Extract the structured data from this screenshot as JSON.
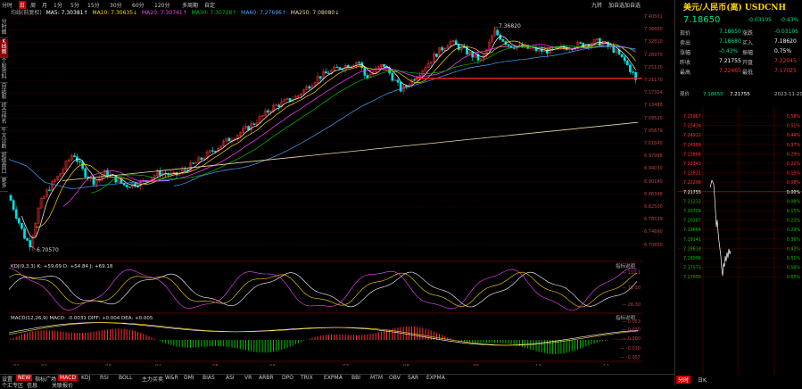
{
  "toolbar": {
    "items": [
      {
        "label": "分时",
        "active": false
      },
      {
        "label": "日",
        "active": true
      },
      {
        "label": "周",
        "active": false
      },
      {
        "label": "月",
        "active": false
      },
      {
        "label": "1分",
        "active": false
      },
      {
        "label": "5分",
        "active": false
      },
      {
        "label": "15分",
        "active": false
      },
      {
        "label": "30分",
        "active": false
      },
      {
        "label": "60分",
        "active": false
      },
      {
        "label": "120分",
        "active": false
      },
      {
        "label": "多周期",
        "active": false
      },
      {
        "label": "自定",
        "active": false
      }
    ],
    "right": [
      "九转",
      "加自选",
      "加自选"
    ]
  },
  "left_tabs": [
    "分时图",
    "K线图",
    "个股资料",
    "自选股",
    "综合排名",
    "牛叉诊断",
    "超级盘口",
    "更多"
  ],
  "ma_legend": {
    "prefix": "均线(前复权)",
    "items": [
      {
        "label": "MA5: 7.30381↑",
        "color": "#ffffff"
      },
      {
        "label": "MA10: 7.30635↓",
        "color": "#ffd700"
      },
      {
        "label": "MA20: 7.30741↑",
        "color": "#ff44ff"
      },
      {
        "label": "MA30: 7.30728↑",
        "color": "#00c000"
      },
      {
        "label": "MA60: 7.27696↑",
        "color": "#4aa3ff"
      },
      {
        "label": "MA250: 7.08080↓",
        "color": "#e8d8a0"
      }
    ]
  },
  "price_axis": [
    "7.40501",
    "7.36660",
    "7.32810",
    "7.28970",
    "7.25120",
    "7.21170",
    "7.17324",
    "7.13488",
    "7.09520",
    "7.05679",
    "7.01840",
    "6.97988",
    "6.94030",
    "6.90180",
    "6.86348",
    "6.82500",
    "6.78539",
    "6.74690",
    "6.70850"
  ],
  "annotations": {
    "high": "7.36820",
    "low": "6.70570",
    "current_marker": "7.21755"
  },
  "kdj": {
    "legend": "KDJ(9,3,3)  K: +59.69   D: +54.84   J: +69.18",
    "label": "指标说明",
    "ticks": [
      "110.1",
      "72.10",
      "26.30"
    ]
  },
  "macd": {
    "legend": "MACD(12,26,9)  MACD: -0.0031  DIFF: +0.004  DEA: +0.005",
    "label": "指标说明",
    "ticks": [
      "0.053",
      "0.030",
      "0.000",
      "-0.030",
      "-0.057"
    ]
  },
  "x_axis": [
    "01",
    "02",
    "03",
    "04",
    "05",
    "06",
    "07",
    "08",
    "09",
    "10",
    "11"
  ],
  "indicator_tabs": [
    {
      "label": "设置",
      "active": false
    },
    {
      "label": "NEW",
      "active": true
    },
    {
      "label": "指标广场",
      "active": false
    },
    {
      "label": "MACD",
      "active": true
    },
    {
      "label": "KDJ",
      "active": false
    },
    {
      "label": "RSI",
      "active": false
    },
    {
      "label": "BOLL",
      "active": false
    },
    {
      "label": "主力买卖",
      "active": false
    },
    {
      "label": "W&R",
      "active": false
    },
    {
      "label": "DMI",
      "active": false
    },
    {
      "label": "BIAS",
      "active": false
    },
    {
      "label": "ASI",
      "active": false
    },
    {
      "label": "VR",
      "active": false
    },
    {
      "label": "ARBR",
      "active": false
    },
    {
      "label": "DPO",
      "active": false
    },
    {
      "label": "TRIX",
      "active": false
    },
    {
      "label": "EXPMA",
      "active": false
    },
    {
      "label": "BBI",
      "active": false
    },
    {
      "label": "MTM",
      "active": false
    },
    {
      "label": "OBV",
      "active": false
    },
    {
      "label": "SAR",
      "active": false
    },
    {
      "label": "EXPMA",
      "active": false
    }
  ],
  "page_tabs": [
    "个汇专区",
    "信息",
    "关联报价"
  ],
  "quote": {
    "title": "美元/人民币(离) USDCNH",
    "price": "7.18650",
    "change": "-0.03105",
    "pct": "-0.43%",
    "rows": [
      [
        "现价",
        "7.18650",
        "涨跌",
        "-0.03105"
      ],
      [
        "卖出",
        "7.18680",
        "买入",
        "7.18620"
      ],
      [
        "涨幅",
        "-0.43%",
        "振幅",
        "0.75%"
      ],
      [
        "昨收",
        "7.21755",
        "开盘",
        "7.22045"
      ],
      [
        "最高",
        "7.22465",
        "最低",
        "7.17025"
      ]
    ]
  },
  "mini": {
    "header": [
      "现价",
      "7.18650",
      "7.21755",
      "2023-11-20"
    ],
    "left_ticks": [
      "7.25967",
      "7.25434",
      "7.24912",
      "7.24389",
      "7.23866",
      "7.23343",
      "7.22821",
      "7.22298",
      "7.21755",
      "7.21232",
      "7.20709",
      "7.20187",
      "7.19664",
      "7.19141",
      "7.18618",
      "7.18096",
      "7.17573",
      "7.17050"
    ],
    "right_ticks": [
      "0.58%",
      "0.51%",
      "0.44%",
      "0.37%",
      "0.29%",
      "0.22%",
      "0.15%",
      "0.08%",
      "0.00%",
      "0.08%",
      "0.15%",
      "0.22%",
      "0.29%",
      "0.36%",
      "0.43%",
      "0.51%",
      "0.58%",
      "0.65%"
    ]
  },
  "bottom_right": [
    "分时",
    "日K"
  ],
  "colors": {
    "up": "#ff3030",
    "down": "#00e0e0",
    "bg": "#000000",
    "grid": "#3a0000"
  }
}
